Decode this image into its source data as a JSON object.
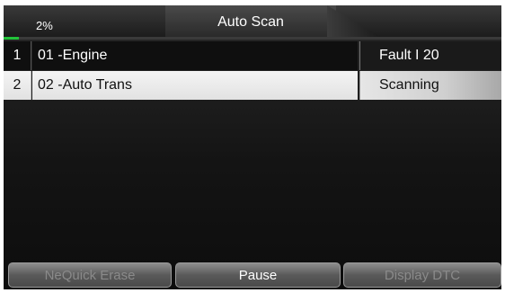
{
  "header": {
    "title": "Auto Scan",
    "progress_text": "2%",
    "progress_fraction": 0.02
  },
  "rows": [
    {
      "index": "1",
      "name": "01 -Engine",
      "status": "Fault I 20"
    },
    {
      "index": "2",
      "name": "02 -Auto Trans",
      "status": "Scanning"
    }
  ],
  "buttons": {
    "erase": "NeQuick Erase",
    "pause": "Pause",
    "display_dtc": "Display DTC"
  },
  "colors": {
    "progress": "#22c33a",
    "background": "#141414"
  }
}
